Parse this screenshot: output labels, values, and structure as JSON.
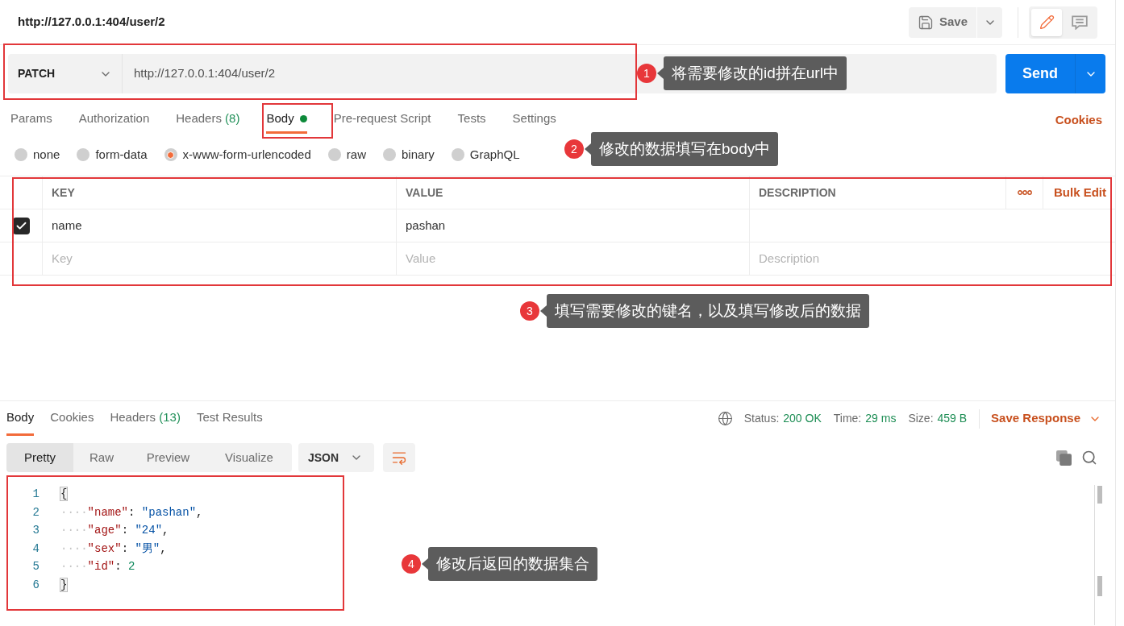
{
  "header": {
    "title": "http://127.0.0.1:404/user/2",
    "save_button": "Save",
    "view_toggle": [
      {
        "kind": "edit",
        "selected": true
      },
      {
        "kind": "comments",
        "selected": false
      }
    ]
  },
  "url_bar": {
    "method": "PATCH",
    "url": "http://127.0.0.1:404/user/2",
    "send_button": "Send"
  },
  "request_tabs": [
    {
      "label": "Params",
      "selected": false,
      "dot": false
    },
    {
      "label": "Authorization",
      "selected": false,
      "dot": false
    },
    {
      "label": "Headers",
      "count": "(8)",
      "selected": false,
      "dot": false
    },
    {
      "label": "Body",
      "selected": true,
      "dot": true
    },
    {
      "label": "Pre-request Script",
      "selected": false,
      "dot": false
    },
    {
      "label": "Tests",
      "selected": false,
      "dot": false
    },
    {
      "label": "Settings",
      "selected": false,
      "dot": false
    }
  ],
  "cookies_link": "Cookies",
  "body_types": [
    {
      "label": "none",
      "selected": false
    },
    {
      "label": "form-data",
      "selected": false
    },
    {
      "label": "x-www-form-urlencoded",
      "selected": true
    },
    {
      "label": "raw",
      "selected": false
    },
    {
      "label": "binary",
      "selected": false
    },
    {
      "label": "GraphQL",
      "selected": false
    }
  ],
  "params_table": {
    "columns": [
      "KEY",
      "VALUE",
      "DESCRIPTION"
    ],
    "bulk_edit": "Bulk Edit",
    "rows": [
      {
        "checked": true,
        "key": "name",
        "value": "pashan"
      }
    ],
    "new_row": {
      "key": {
        "placeholder": "Key"
      },
      "value": {
        "placeholder": "Value"
      },
      "description": {
        "placeholder": "Description"
      }
    }
  },
  "response": {
    "tabs": [
      {
        "label": "Body",
        "selected": true
      },
      {
        "label": "Cookies",
        "selected": false
      },
      {
        "label": "Headers",
        "count": "(13)",
        "selected": false
      },
      {
        "label": "Test Results",
        "selected": false
      }
    ],
    "status": {
      "label": "Status:",
      "value": "200 OK"
    },
    "time": {
      "label": "Time:",
      "value": "29 ms"
    },
    "size": {
      "label": "Size:",
      "value": "459 B"
    },
    "save_response": "Save Response",
    "view_modes": [
      {
        "label": "Pretty",
        "selected": true
      },
      {
        "label": "Raw",
        "selected": false
      },
      {
        "label": "Preview",
        "selected": false
      },
      {
        "label": "Visualize",
        "selected": false
      }
    ],
    "format": "JSON",
    "lines": [
      {
        "number": "1",
        "tokens": [
          {
            "kind": "bracket",
            "text": "{"
          }
        ]
      },
      {
        "number": "2",
        "tokens": [
          {
            "kind": "whitespace",
            "text": "····"
          },
          {
            "kind": "key",
            "text": "\"name\""
          },
          {
            "kind": "punct",
            "text": ": "
          },
          {
            "kind": "string",
            "text": "\"pashan\""
          },
          {
            "kind": "punct",
            "text": ","
          }
        ]
      },
      {
        "number": "3",
        "tokens": [
          {
            "kind": "whitespace",
            "text": "····"
          },
          {
            "kind": "key",
            "text": "\"age\""
          },
          {
            "kind": "punct",
            "text": ": "
          },
          {
            "kind": "string",
            "text": "\"24\""
          },
          {
            "kind": "punct",
            "text": ","
          }
        ]
      },
      {
        "number": "4",
        "tokens": [
          {
            "kind": "whitespace",
            "text": "····"
          },
          {
            "kind": "key",
            "text": "\"sex\""
          },
          {
            "kind": "punct",
            "text": ": "
          },
          {
            "kind": "string",
            "text": "\"男\""
          },
          {
            "kind": "punct",
            "text": ","
          }
        ]
      },
      {
        "number": "5",
        "tokens": [
          {
            "kind": "whitespace",
            "text": "····"
          },
          {
            "kind": "key",
            "text": "\"id\""
          },
          {
            "kind": "punct",
            "text": ": "
          },
          {
            "kind": "number",
            "text": "2"
          }
        ]
      },
      {
        "number": "6",
        "tokens": [
          {
            "kind": "bracket",
            "text": "}"
          }
        ]
      }
    ]
  },
  "annotations": [
    {
      "number": "1",
      "text": "将需要修改的id拼在url中"
    },
    {
      "number": "2",
      "text": "修改的数据填写在body中"
    },
    {
      "number": "3",
      "text": "填写需要修改的键名，以及填写修改后的数据"
    },
    {
      "number": "4",
      "text": "修改后返回的数据集合"
    }
  ]
}
